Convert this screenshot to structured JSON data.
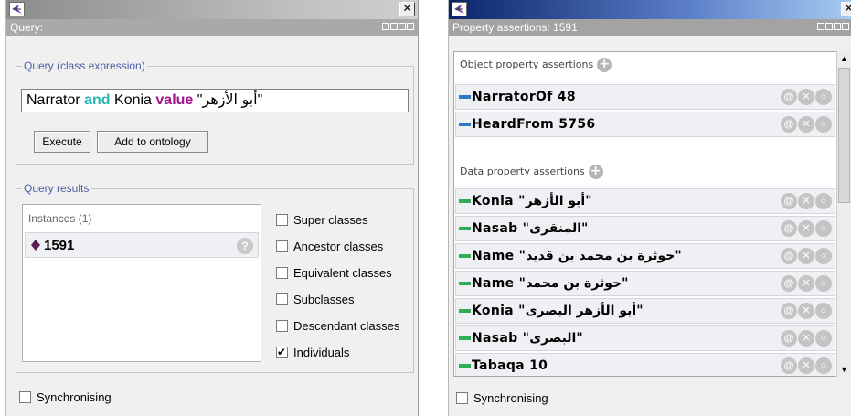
{
  "left": {
    "view_title": "Query:",
    "query_group_title": "Query (class expression)",
    "query": {
      "part1": "Narrator ",
      "kw_and": "and",
      "part2": " Konia ",
      "kw_value": "value",
      "part3": " \"أبو الأزهر\""
    },
    "execute_label": "Execute",
    "add_label": "Add to ontology",
    "results_group_title": "Query results",
    "instances_header": "Instances (1)",
    "instance": "1591",
    "options": [
      {
        "label": "Super classes",
        "checked": false
      },
      {
        "label": "Ancestor classes",
        "checked": false
      },
      {
        "label": "Equivalent classes",
        "checked": false
      },
      {
        "label": "Subclasses",
        "checked": false
      },
      {
        "label": "Descendant classes",
        "checked": false
      },
      {
        "label": "Individuals",
        "checked": true
      }
    ],
    "sync_label": "Synchronising"
  },
  "right": {
    "view_title": "Property assertions: 1591",
    "object_section": "Object property assertions",
    "object_rows": [
      {
        "text": "NarratorOf  48"
      },
      {
        "text": "HeardFrom  5756"
      }
    ],
    "data_section": "Data property assertions",
    "data_rows": [
      {
        "text": "Konia  \"أبو الأزهر\""
      },
      {
        "text": "Nasab  \"المنقرى\""
      },
      {
        "text": "Name  \"حوثرة بن محمد بن قديد\""
      },
      {
        "text": "Name  \"حوثرة بن محمد\""
      },
      {
        "text": "Konia  \"أبو الأزهر البصرى\""
      },
      {
        "text": "Nasab  \"البصرى\""
      },
      {
        "text": "Tabaqa  10"
      }
    ],
    "sync_label": "Synchronising"
  },
  "colors": {
    "object_swatch": "#2f78c4",
    "data_swatch": "#2fae55",
    "keyword_and": "#2ab5b5",
    "keyword_value": "#a1148c",
    "group_title": "#4a5fa5",
    "instance_icon": "#5a1f5a"
  },
  "icons": {
    "app": "protege-app-icon",
    "close": "close-icon",
    "plus": "plus-icon",
    "instance": "diamond-icon",
    "help": "help-icon",
    "row_actions": [
      "annotate-icon",
      "delete-icon",
      "edit-icon"
    ]
  }
}
